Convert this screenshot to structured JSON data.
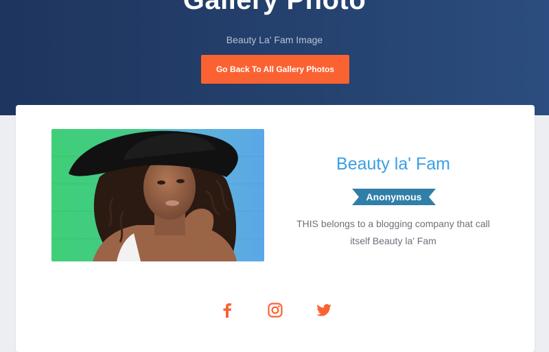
{
  "hero": {
    "title": "Gallery Photo",
    "subtitle": "Beauty La' Fam Image",
    "back_button_label": "Go Back To All Gallery Photos"
  },
  "profile": {
    "name": "Beauty la' Fam",
    "badge": "Anonymous",
    "description": "THIS belongs to a blogging company that call itself Beauty la' Fam"
  },
  "social": [
    {
      "icon": "facebook-icon"
    },
    {
      "icon": "instagram-icon"
    },
    {
      "icon": "twitter-icon"
    }
  ],
  "colors": {
    "accent": "#fb6232",
    "name": "#3a9ee4",
    "badge": "#2f7fa8",
    "hero": "#24406c"
  }
}
